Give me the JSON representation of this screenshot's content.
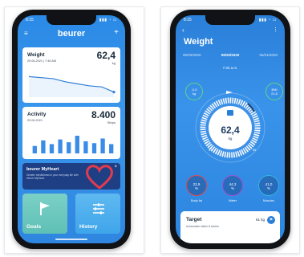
{
  "left_phone": {
    "status": {
      "time": "8:15",
      "icons": "▮▮▮ ◔ ▭"
    },
    "header": {
      "menu_icon": "≡",
      "logo": "beurer",
      "add_icon": "+"
    },
    "weight_tile": {
      "title": "Weight",
      "date": "29.06.2021 | 7:46 AM",
      "value": "62,4",
      "unit": "kg",
      "chart_data": {
        "type": "line",
        "values": [
          78,
          77,
          76,
          73,
          71,
          69,
          68,
          63
        ]
      }
    },
    "activity_tile": {
      "title": "Activity",
      "date": "29.06.2021",
      "value": "8.400",
      "unit": "Steps",
      "chart_data": {
        "type": "bar",
        "values": [
          40,
          70,
          50,
          75,
          60,
          95,
          65,
          55,
          80,
          50
        ]
      }
    },
    "banner": {
      "title": "beurer MyHeart",
      "text": "Greater mindfulness in your everyday life with beurer MyHeart.",
      "close_icon": "×"
    },
    "goals": {
      "label": "Goals",
      "icon": "flag-icon"
    },
    "history": {
      "label": "History",
      "icon": "history-icon"
    }
  },
  "right_phone": {
    "status": {
      "time": "8:15",
      "icons": "▮▮▮ ◔ ▭"
    },
    "back_icon": "‹",
    "more_icon": "⋮",
    "title": "Weight",
    "dates": [
      "05/20/2020",
      "06/20/2020",
      "06/21/2020"
    ],
    "time": "7:34 a.m.",
    "left_ring": {
      "value": "-0,5",
      "unit": "kg"
    },
    "right_ring": {
      "label": "BMI",
      "value": "21,6"
    },
    "gauge": {
      "value": "62,4",
      "unit": "kg",
      "min": "57",
      "max": "65"
    },
    "metrics": [
      {
        "value": "22,9",
        "unit": "%",
        "label": "Body fat",
        "color": "#e14848"
      },
      {
        "value": "44,3",
        "unit": "%",
        "label": "Water",
        "color": "#a14fd0"
      },
      {
        "value": "41,0",
        "unit": "%",
        "label": "Muscles",
        "color": "#2fb8e0"
      }
    ],
    "target": {
      "title": "Target",
      "subtitle": "Achievable within 8 weeks",
      "value": "61 kg",
      "flag_icon": "⚑"
    }
  }
}
